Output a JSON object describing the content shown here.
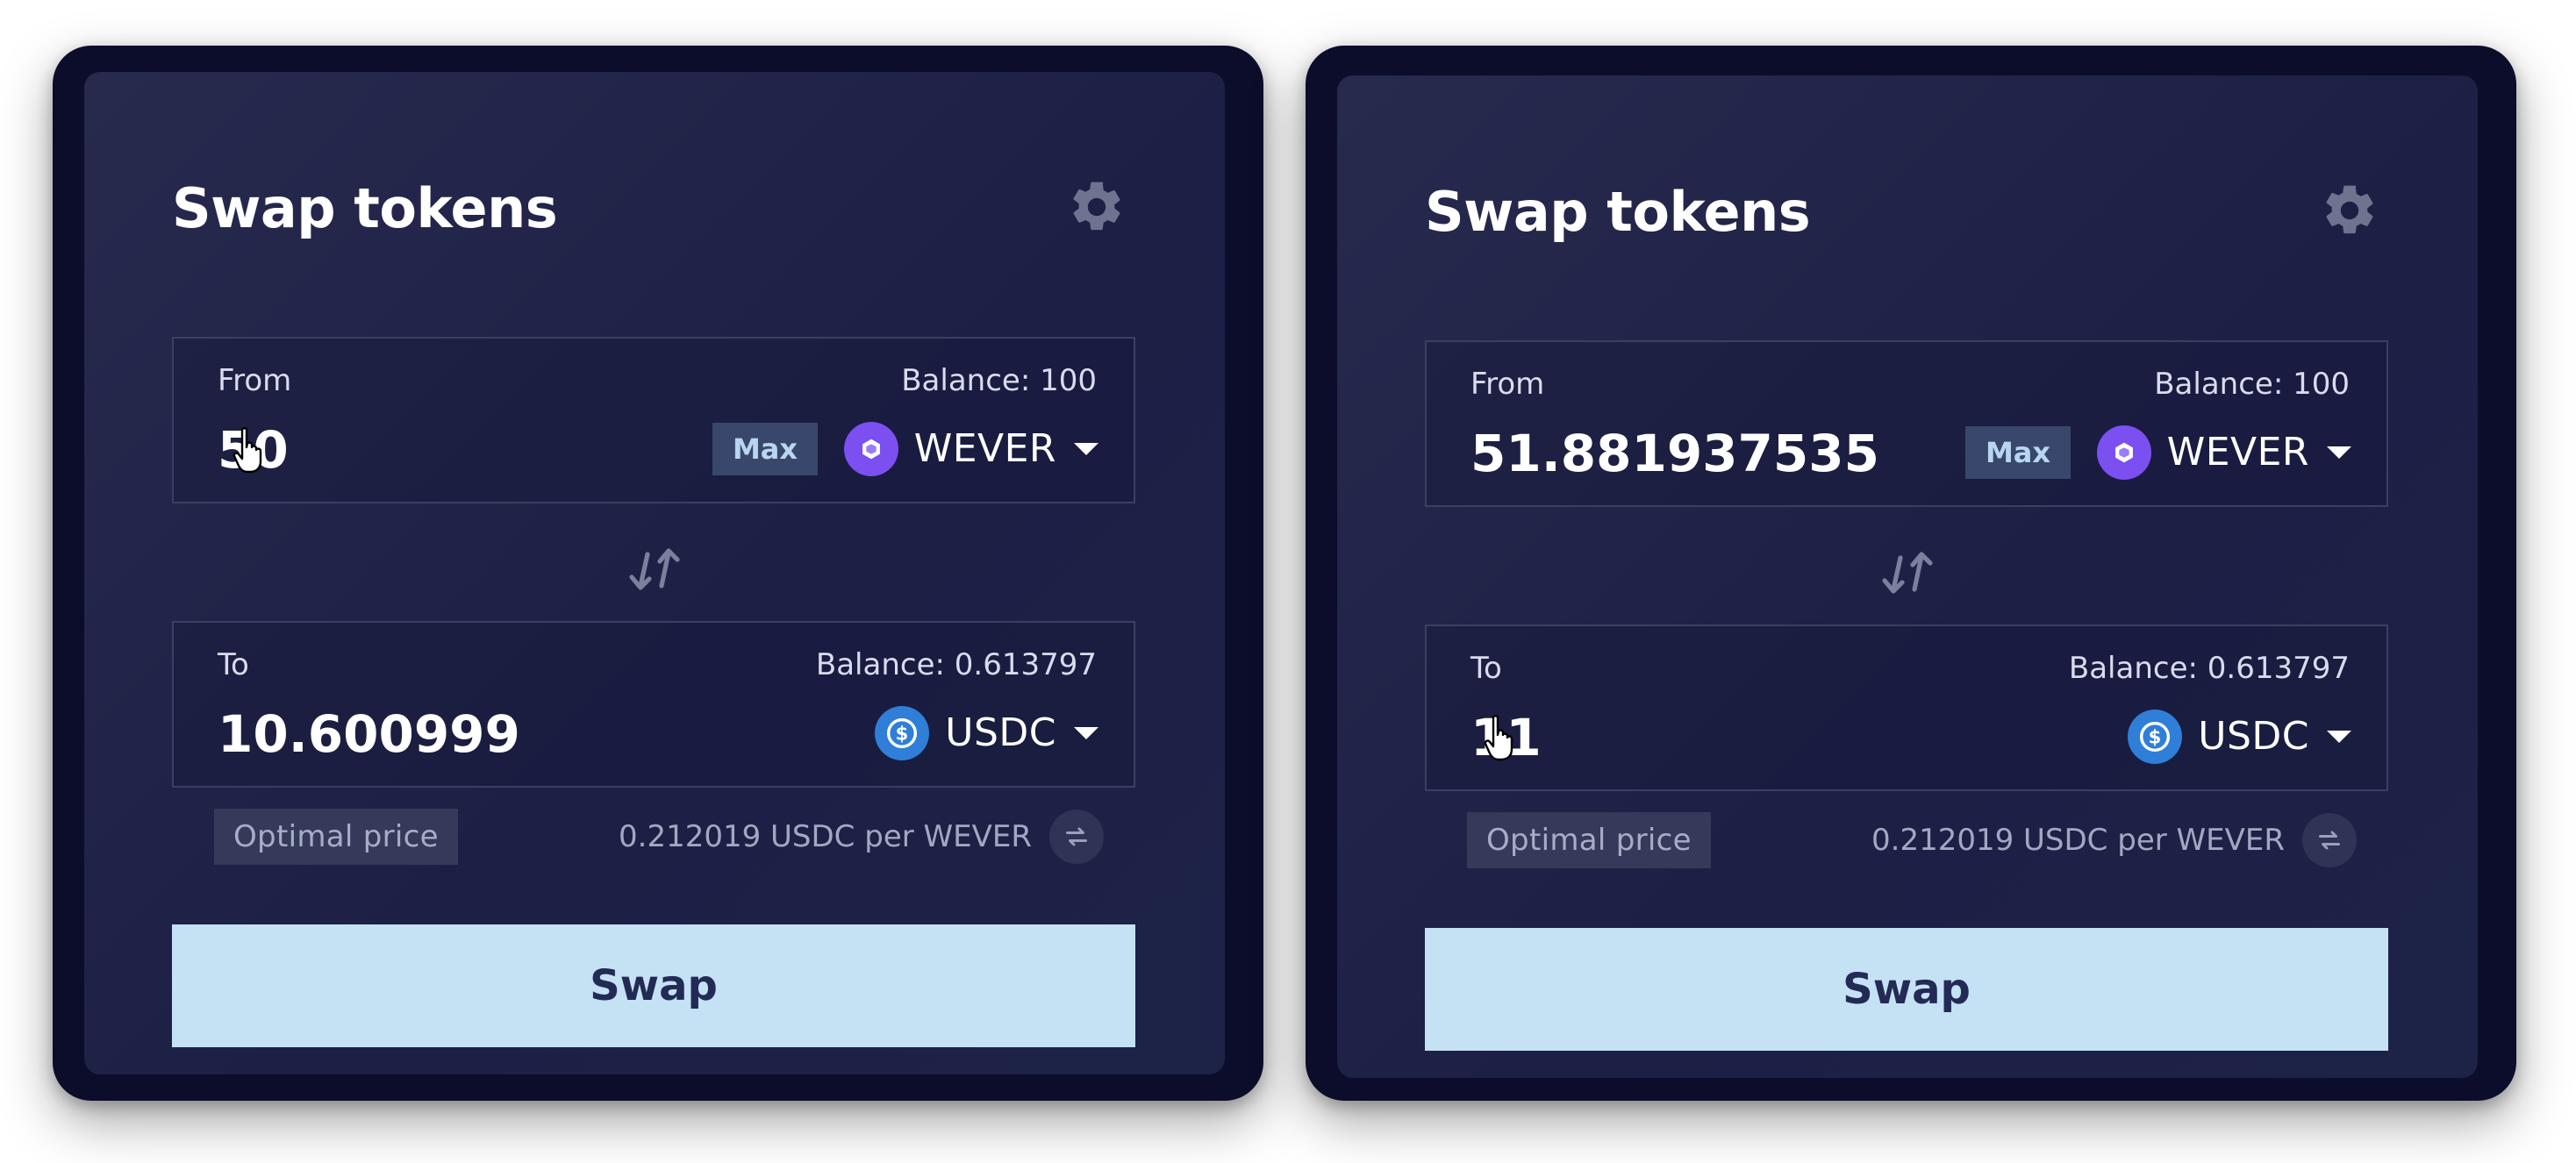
{
  "colors": {
    "page_bg": "#ffffff",
    "frame_bg": "#0b0d2a",
    "card_bg": "#22254a",
    "field_border": "#3a3f63",
    "swap_button_bg": "#c5e2f4",
    "swap_button_text": "#232a55",
    "max_button_bg": "#39476c",
    "wever_icon": "#7b4ff0",
    "usdc_icon": "#2f7fd8"
  },
  "panels": [
    {
      "title": "Swap tokens",
      "settings_icon": "gear-icon",
      "from": {
        "label": "From",
        "balance": "Balance: 100",
        "amount": "50",
        "max_label": "Max",
        "token": "WEVER",
        "token_icon": "wever-icon"
      },
      "direction_icon": "swap-direction-icon",
      "to": {
        "label": "To",
        "balance": "Balance: 0.613797",
        "amount": "10.600999",
        "token": "USDC",
        "token_icon": "usdc-icon"
      },
      "price_badge": "Optimal price",
      "price_text": "0.212019 USDC per WEVER",
      "refresh_icon": "refresh-icon",
      "swap_label": "Swap",
      "cursor": "hand-pointer-icon"
    },
    {
      "title": "Swap tokens",
      "settings_icon": "gear-icon",
      "from": {
        "label": "From",
        "balance": "Balance: 100",
        "amount": "51.881937535",
        "max_label": "Max",
        "token": "WEVER",
        "token_icon": "wever-icon"
      },
      "direction_icon": "swap-direction-icon",
      "to": {
        "label": "To",
        "balance": "Balance: 0.613797",
        "amount": "11",
        "token": "USDC",
        "token_icon": "usdc-icon"
      },
      "price_badge": "Optimal price",
      "price_text": "0.212019 USDC per WEVER",
      "refresh_icon": "refresh-icon",
      "swap_label": "Swap",
      "cursor": "hand-pointer-icon"
    }
  ]
}
